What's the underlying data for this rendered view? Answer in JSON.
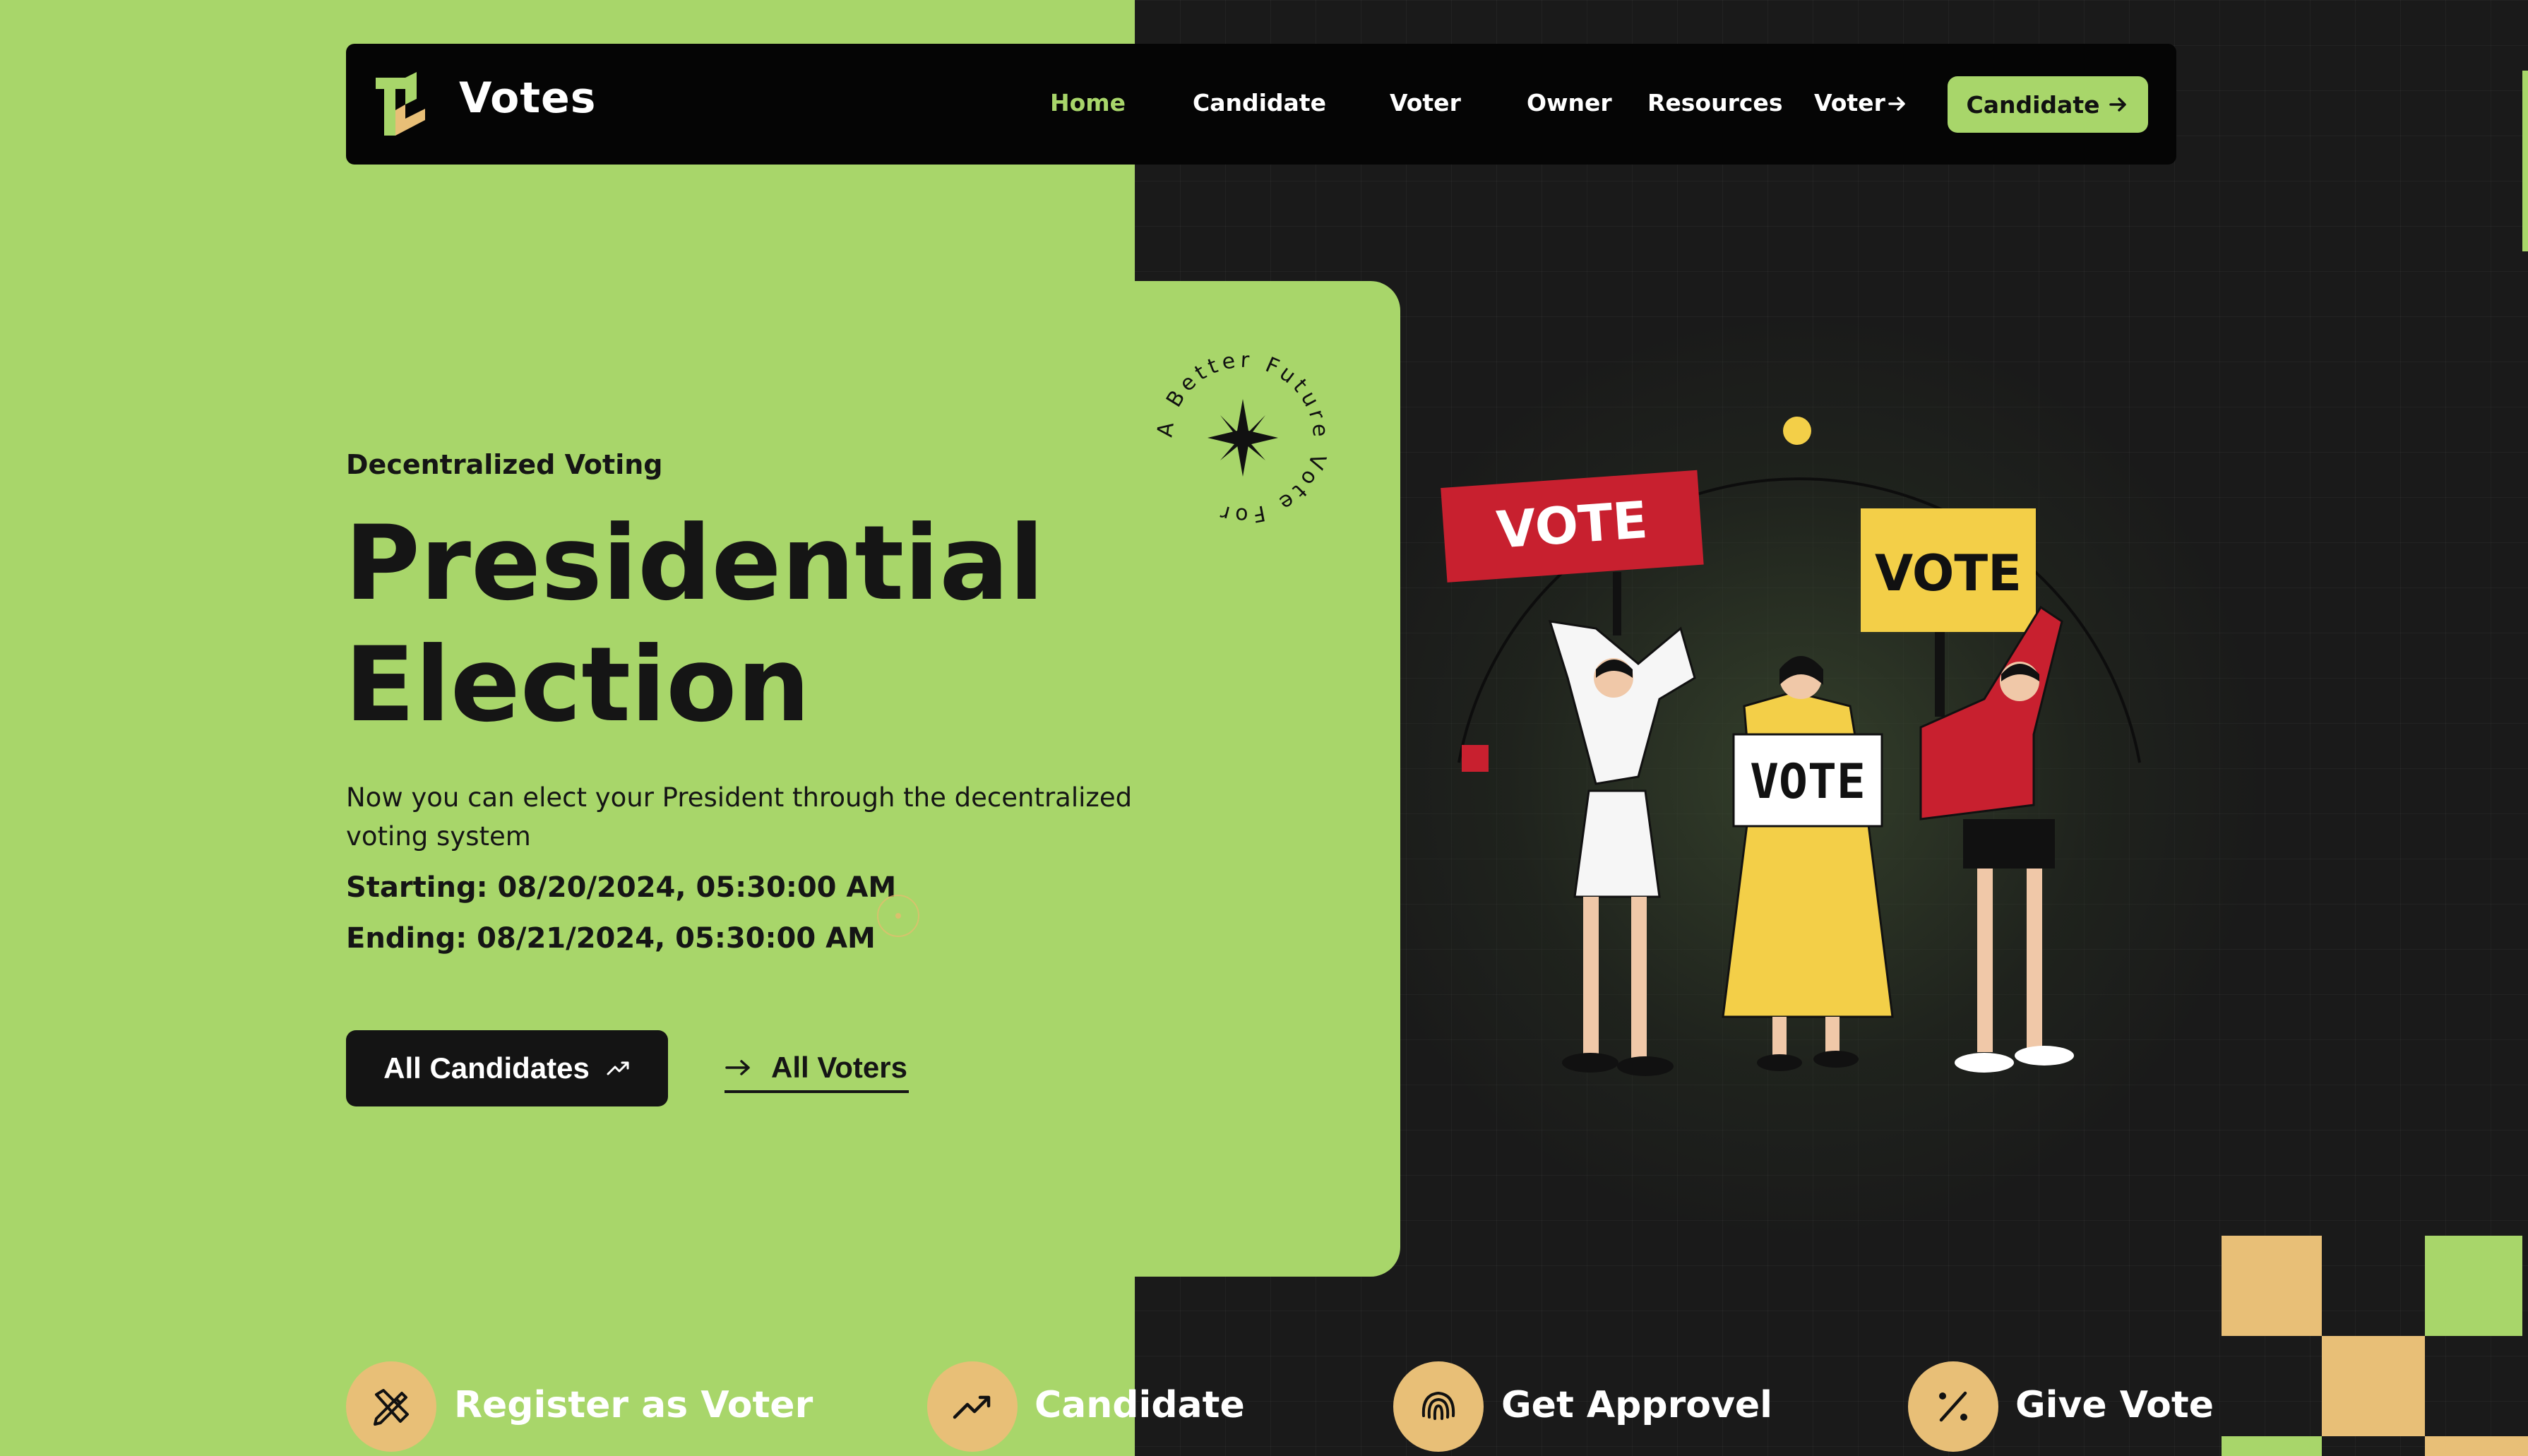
{
  "brand": {
    "name": "Votes"
  },
  "nav": {
    "items": [
      {
        "label": "Home",
        "active": true
      },
      {
        "label": "Candidate"
      },
      {
        "label": "Voter"
      },
      {
        "label": "Owner"
      },
      {
        "label": "Resources"
      },
      {
        "label": "Voter"
      }
    ],
    "cta": "Candidate"
  },
  "hero": {
    "eyebrow": "Decentralized Voting",
    "title_line1": "Presidential",
    "title_line2": "Election",
    "description": "Now you can elect your President through the decentralized voting system",
    "starting": "Starting: 08/20/2024, 05:30:00 AM",
    "ending": "Ending: 08/21/2024, 05:30:00 AM",
    "primary_button": "All Candidates",
    "secondary_link": "All Voters",
    "badge_text": "A Better Future Vote For"
  },
  "illustration": {
    "signs": [
      "VOTE",
      "VOTE",
      "VOTE"
    ]
  },
  "features": [
    {
      "label": "Register as Voter",
      "icon": "pencil-ruler-icon"
    },
    {
      "label": "Candidate",
      "icon": "trending-up-icon"
    },
    {
      "label": "Get Approvel",
      "icon": "fingerprint-icon"
    },
    {
      "label": "Give Vote",
      "icon": "percent-icon"
    }
  ],
  "colors": {
    "accent_green": "#a8d66a",
    "dark": "#1a1a1a",
    "gold": "#e8bf77",
    "red": "#c8202f",
    "yellow": "#f3cf48"
  }
}
